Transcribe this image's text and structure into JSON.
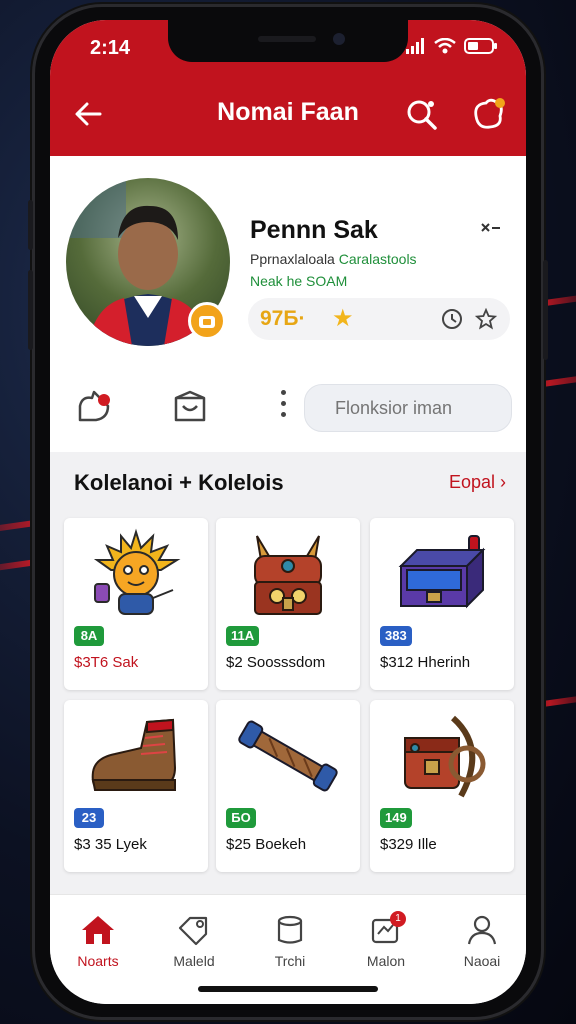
{
  "status_bar": {
    "time": "2:14"
  },
  "header": {
    "title": "Nomai Faan",
    "back_icon": "back-arrow-icon",
    "search_icon": "search-icon",
    "notif_icon": "notification-icon"
  },
  "profile": {
    "name": "Pennn Sak",
    "sub_line_1a": "Pprnaxlaloala",
    "sub_line_1b": "Caralastools",
    "sub_line_2": "Neak he SOAM",
    "rating": "97Б·",
    "accent": "#c1131e"
  },
  "actions": {
    "input_placeholder": "Flonksior iman"
  },
  "collection": {
    "title": "Kolelanoi + Kolelois",
    "see_all": "Eopal",
    "items": [
      {
        "tag": "8A",
        "tag_color": "#1f9a3b",
        "price": "$3Т6 Sak",
        "price_red": true,
        "art": "sun-mascot"
      },
      {
        "tag": "11A",
        "tag_color": "#1f9a3b",
        "price": "$2 Soosssdom",
        "price_red": false,
        "art": "chest-creature"
      },
      {
        "tag": "383",
        "tag_color": "#2a5fc4",
        "price": "$312 Hherinh",
        "price_red": false,
        "art": "loot-box"
      },
      {
        "tag": "23",
        "tag_color": "#2a5fc4",
        "price": "$3 35 Lyek",
        "price_red": false,
        "art": "boot"
      },
      {
        "tag": "БО",
        "tag_color": "#1f9a3b",
        "price": "$25 Boekeh",
        "price_red": false,
        "art": "scroll-staff"
      },
      {
        "tag": "149",
        "tag_color": "#1f9a3b",
        "price": "$329 Ille",
        "price_red": false,
        "art": "crossbow-chest"
      }
    ]
  },
  "tabs": [
    {
      "label": "Noarts",
      "icon": "home-icon",
      "active": true
    },
    {
      "label": "Maleld",
      "icon": "tag-icon",
      "active": false
    },
    {
      "label": "Trchi",
      "icon": "jar-icon",
      "active": false
    },
    {
      "label": "Malon",
      "icon": "message-icon",
      "active": false,
      "badge": "1"
    },
    {
      "label": "Naoai",
      "icon": "profile-icon",
      "active": false
    }
  ]
}
